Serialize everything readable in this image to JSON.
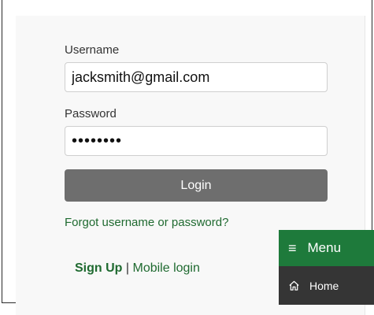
{
  "login_form": {
    "username_label": "Username",
    "username_value": "jacksmith@gmail.com",
    "password_label": "Password",
    "password_value": "••••••••",
    "login_button": "Login",
    "forgot_link": "Forgot username or password?",
    "signup_link": "Sign Up",
    "separator": "|",
    "mobile_login_link": "Mobile login"
  },
  "menu": {
    "icon": "hamburger-icon",
    "title": "Menu",
    "items": [
      {
        "icon": "home-icon",
        "label": "Home"
      }
    ]
  },
  "colors": {
    "menu_header": "#1e7a3b",
    "menu_item_bg": "#353535",
    "link_green": "#1f6a30",
    "login_button_bg": "#6e6e6e"
  }
}
